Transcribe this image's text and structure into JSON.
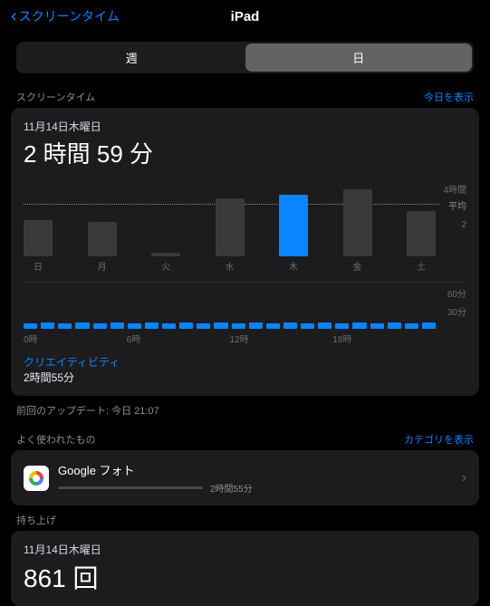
{
  "nav": {
    "back": "スクリーンタイム",
    "title": "iPad"
  },
  "seg": {
    "week": "週",
    "day": "日"
  },
  "screentime": {
    "header": "スクリーンタイム",
    "show_today": "今日を表示",
    "date": "11月14日木曜日",
    "total": "2 時間 59 分",
    "category_name": "クリエイティビティ",
    "category_value": "2時間55分"
  },
  "chart_data": {
    "type": "bar",
    "categories": [
      "日",
      "月",
      "火",
      "水",
      "木",
      "金",
      "土"
    ],
    "values": [
      2.0,
      1.9,
      0.2,
      3.2,
      3.4,
      3.7,
      2.5
    ],
    "ylim": [
      0,
      4
    ],
    "yticks": [
      "4時間",
      "2"
    ],
    "avg_label": "平均",
    "avg_value": 3.0,
    "highlight_index": 4,
    "hourly": {
      "x_ticks": [
        "0時",
        "6時",
        "12時",
        "18時"
      ],
      "y_ticks": [
        "60分",
        "30分"
      ],
      "values": [
        6,
        7,
        6,
        7,
        6,
        7,
        6,
        7,
        6,
        7,
        6,
        7,
        6,
        7,
        6,
        7,
        6,
        7,
        6,
        7,
        6,
        7,
        6,
        7
      ]
    }
  },
  "update": "前回のアップデート: 今日 21:07",
  "most_used": {
    "header": "よく使われたもの",
    "show_categories": "カテゴリを表示",
    "apps": [
      {
        "name": "Google フォト",
        "time": "2時間55分"
      }
    ]
  },
  "pickups": {
    "header": "持ち上げ",
    "date": "11月14日木曜日",
    "count": "861 回"
  }
}
